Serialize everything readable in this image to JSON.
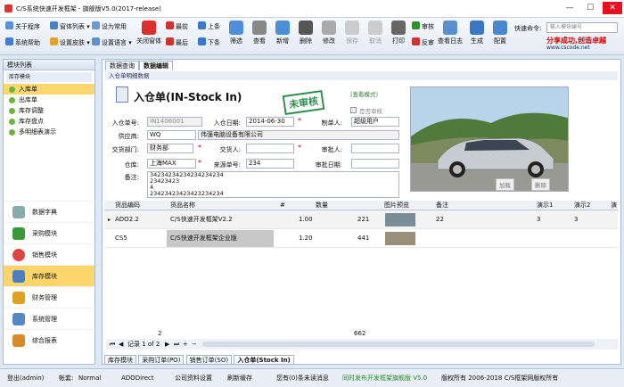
{
  "window": {
    "title": "C/S系统快速开发框架 - 旗舰版V5.0(2017-release)"
  },
  "ribbon": {
    "row1": [
      "关于程序",
      "窗体列表",
      "设为常用"
    ],
    "row2": [
      "系统帮助",
      "设置皮肤",
      "设置语言"
    ],
    "close_window": "关闭窗体",
    "nav1": [
      "最前",
      "上条"
    ],
    "nav2": [
      "最后",
      "下条"
    ],
    "actions": [
      "筛选",
      "查看",
      "新增",
      "删除",
      "修改",
      "保存",
      "取消",
      "打印"
    ],
    "approve": "审核",
    "unapprove": "反审",
    "approve_log": "查看日志",
    "generate": "生成",
    "config": "配置",
    "quick_cmd_label": "快速命令:",
    "quick_cmd_placeholder": "输入模块编号",
    "slogan": "分享成功,创造卓越",
    "site": "www.cscode.net"
  },
  "sidebar": {
    "title": "模块列表",
    "group": "库存模块",
    "items": [
      "入库单",
      "出库单",
      "库存调整",
      "库存盘点",
      "多明细表演示"
    ],
    "modules": [
      "数据字典",
      "采购模块",
      "销售模块",
      "库存模块",
      "财务管理",
      "系统管理",
      "综合报表"
    ]
  },
  "main": {
    "tabs": [
      "数据查询",
      "数据编辑"
    ],
    "section": "入仓单明细数据",
    "doc_title": "入仓单(IN-Stock In)",
    "stamp": "未审核",
    "mode": "(查看模式)",
    "approved_chk": "是否审核",
    "fields": {
      "doc_no_label": "入仓单号:",
      "doc_no": "IN1406001",
      "date_label": "入仓日期:",
      "date": "2014-06-30",
      "maker_label": "制单人:",
      "maker": "超级用户",
      "supplier_label": "供应商:",
      "supplier_code": "WQ",
      "supplier_name": "伟强电脑设备有限公司",
      "dept_label": "交货部门:",
      "dept": "财务部",
      "deliverer_label": "交货人:",
      "deliverer": "",
      "approver_label": "审批人:",
      "approver": "",
      "warehouse_label": "仓库:",
      "warehouse": "上海MAX",
      "source_label": "来源单号:",
      "source": "234",
      "approve_date_label": "审批日期:",
      "approve_date": "",
      "remark_label": "备注:",
      "remark": [
        "34234234234234234234",
        "23423423",
        "4",
        "23423423423423234234"
      ]
    },
    "photo_btns": [
      "加载",
      "删除"
    ],
    "grid": {
      "headers": [
        "货品编码",
        "货品名称",
        "#",
        "数量",
        "图片预览",
        "备注",
        "演示1",
        "演示2",
        "演"
      ],
      "rows": [
        {
          "code": "ADO2.2",
          "name": "C/S快速开发框架V2.2",
          "price": "1.00",
          "qty": "221",
          "note": "22",
          "d1": "3",
          "d2": "3"
        },
        {
          "code": "CS5",
          "name": "C/S快速开发框架企业版",
          "price": "1.20",
          "qty": "441",
          "note": "",
          "d1": "",
          "d2": ""
        }
      ],
      "sum_count": "2",
      "sum_qty": "662"
    },
    "pager": "记录 1 of 2",
    "bottom_tabs": [
      "库存模块",
      "采购订单(PO)",
      "销售订单(SO)",
      "入仓单(Stock In)"
    ]
  },
  "status": {
    "user": "登出(admin)",
    "account_label": "帐套:",
    "account": "Normal",
    "conn": "ADODirect",
    "company": "公司资料设置",
    "refresh": "刷新缓存",
    "msg": "您有(0)条未读消息",
    "release": "同时发布开发框架旗舰版 V5.0",
    "copyright": "版权所有 2006-2018 C/S框架网版权所有"
  }
}
